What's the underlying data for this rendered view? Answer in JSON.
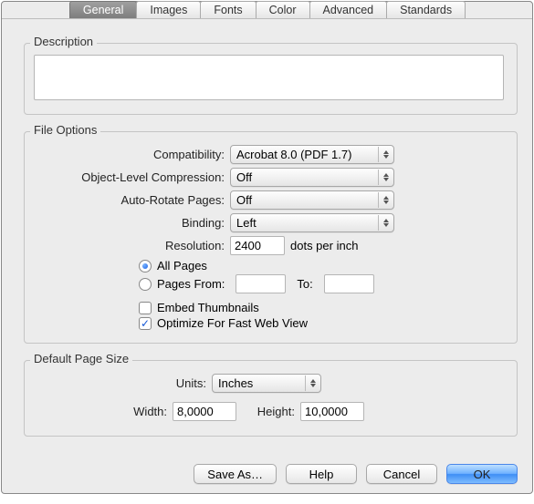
{
  "tabs": {
    "general": "General",
    "images": "Images",
    "fonts": "Fonts",
    "color": "Color",
    "advanced": "Advanced",
    "standards": "Standards"
  },
  "groups": {
    "description": "Description",
    "file_options": "File Options",
    "default_page_size": "Default Page Size"
  },
  "labels": {
    "compatibility": "Compatibility:",
    "object_level_compression": "Object-Level Compression:",
    "auto_rotate_pages": "Auto-Rotate Pages:",
    "binding": "Binding:",
    "resolution": "Resolution:",
    "dots_per_inch": "dots per inch",
    "all_pages": "All Pages",
    "pages_from": "Pages From:",
    "to": "To:",
    "embed_thumbnails": "Embed Thumbnails",
    "optimize_fast_web": "Optimize For Fast Web View",
    "units": "Units:",
    "width": "Width:",
    "height": "Height:"
  },
  "values": {
    "compatibility": "Acrobat 8.0 (PDF 1.7)",
    "object_level_compression": "Off",
    "auto_rotate_pages": "Off",
    "binding": "Left",
    "resolution": "2400",
    "pages_from": "",
    "pages_to": "",
    "units": "Inches",
    "width": "8,0000",
    "height": "10,0000",
    "description": ""
  },
  "state": {
    "page_range": "all",
    "embed_thumbnails": false,
    "optimize_fast_web": true
  },
  "buttons": {
    "save_as": "Save As…",
    "help": "Help",
    "cancel": "Cancel",
    "ok": "OK"
  }
}
